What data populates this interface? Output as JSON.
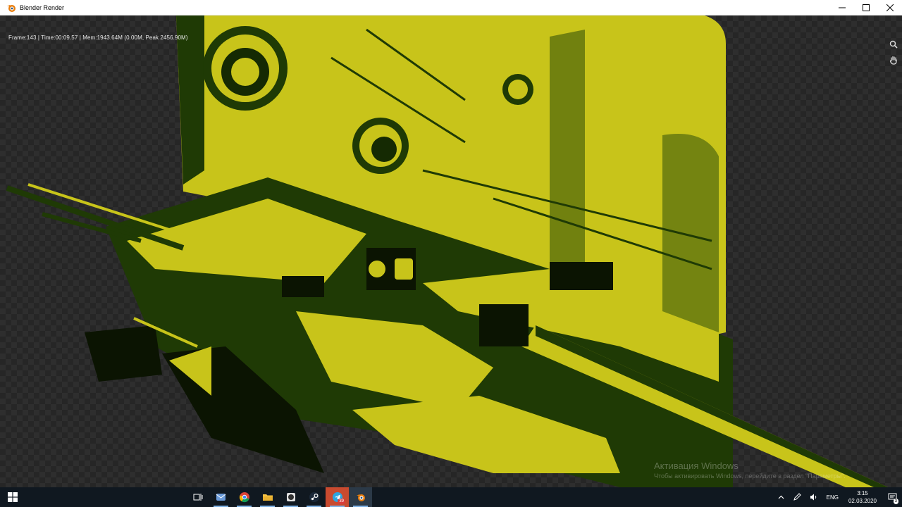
{
  "window": {
    "title": "Blender Render",
    "app_icon": "blender-icon",
    "controls": [
      "minimize-icon",
      "maximize-icon",
      "close-icon"
    ]
  },
  "render": {
    "stats": "Frame:143 | Time:00:09.57 | Mem:1943.64M (0.00M, Peak 2456.90M)",
    "tools": [
      "zoom-icon",
      "hand-icon"
    ]
  },
  "watermark": {
    "title": "Активация Windows",
    "subtitle": "Чтобы активировать Windows, перейдите в раздел \"Параметры\"."
  },
  "taskbar": {
    "apps": [
      {
        "name": "task-view",
        "icon": "task-view-icon"
      },
      {
        "name": "mail",
        "icon": "mail-icon",
        "badge": ""
      },
      {
        "name": "chrome",
        "icon": "chrome-icon"
      },
      {
        "name": "file-explorer",
        "icon": "folder-icon"
      },
      {
        "name": "obs",
        "icon": "obs-icon"
      },
      {
        "name": "steam",
        "icon": "steam-icon"
      },
      {
        "name": "telegram",
        "icon": "telegram-icon",
        "badge": "39"
      },
      {
        "name": "blender",
        "icon": "blender-icon"
      }
    ],
    "tray": {
      "language": "ENG",
      "time": "3:15",
      "date": "02.03.2020",
      "notifications": "3"
    }
  },
  "colors": {
    "render_yellow": "#c8c41a",
    "render_dark": "#1f3a05",
    "taskbar": "#101820"
  }
}
